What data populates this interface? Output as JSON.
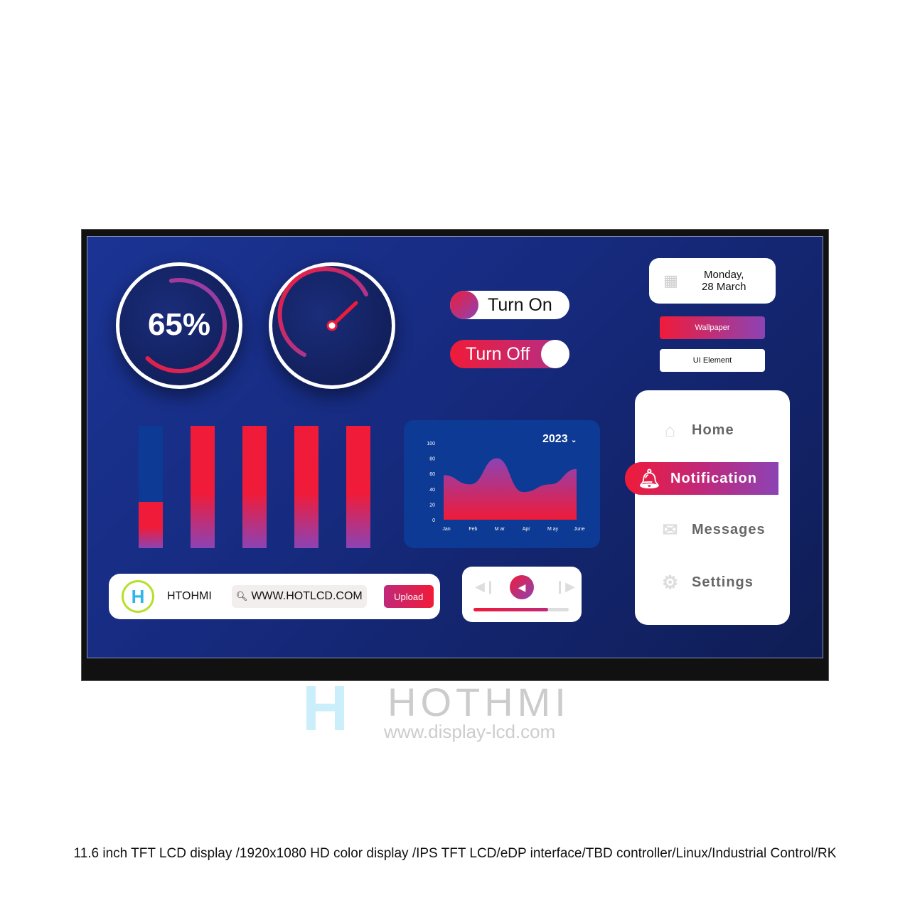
{
  "gauge1": {
    "value_label": "65%",
    "percent": 65
  },
  "gauge2": {
    "needle_percent": 70
  },
  "toggles": {
    "on_label": "Turn On",
    "off_label": "Turn Off"
  },
  "date": {
    "line1": "Monday,",
    "line2": "28 March",
    "icon": "calendar-icon"
  },
  "buttons": {
    "wallpaper": "Wallpaper",
    "ui_element": "UI Element",
    "upload": "Upload"
  },
  "bars": {
    "levels_percent": [
      38,
      100,
      100,
      100,
      100
    ],
    "colors": {
      "red": "#f01b39",
      "purple": "#8c43b5",
      "blue": "#0d3a94"
    }
  },
  "chart_data": {
    "type": "area",
    "year_label": "2023",
    "categories": [
      "Jan",
      "Feb",
      "M ar",
      "Apr",
      "M ay",
      "June"
    ],
    "values": [
      58,
      46,
      80,
      36,
      46,
      66
    ],
    "ylim": [
      0,
      100
    ],
    "yticks": [
      0,
      20,
      40,
      60,
      80,
      100
    ]
  },
  "menu": {
    "items": [
      {
        "label": "Home",
        "icon": "home-icon"
      },
      {
        "label": "Notification",
        "icon": "bell-icon",
        "active": true
      },
      {
        "label": "Messages",
        "icon": "mail-icon"
      },
      {
        "label": "Settings",
        "icon": "gear-icon"
      }
    ]
  },
  "searchbar": {
    "brand": "HTOHMI",
    "url": "WWW.HOTLCD.COM"
  },
  "player": {
    "progress_percent": 78
  },
  "watermark": {
    "brand": "HOTHMI",
    "site": "www.display-lcd.com"
  },
  "caption": "11.6 inch TFT LCD display /1920x1080 HD color display /IPS TFT LCD/eDP interface/TBD controller/Linux/Industrial Control/RK"
}
